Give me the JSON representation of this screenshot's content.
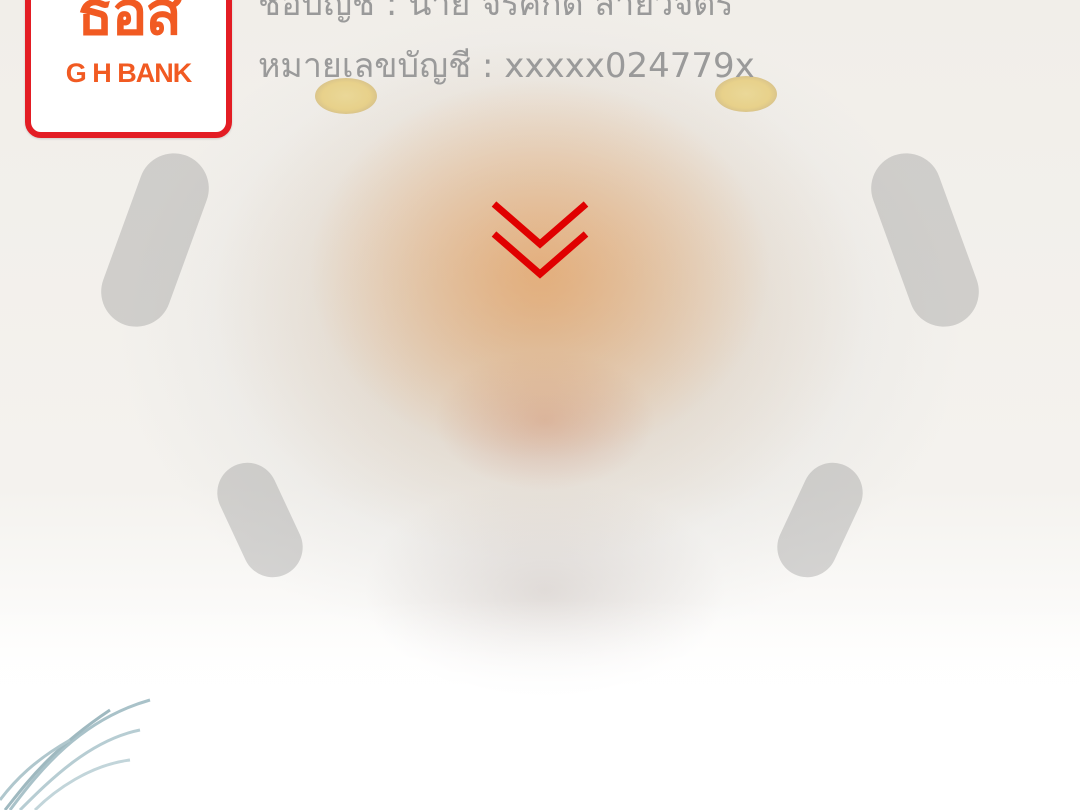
{
  "logo": {
    "thai_text": "ธอส",
    "english_text": "G H BANK",
    "border_color": "#e31d24",
    "text_color": "#f15a22"
  },
  "account": {
    "name_line": "ชื่อบัญชี : นาย จีรศักดิ์ สายวิจิตร",
    "number_line": "หมายเลขบัญชี : xxxxx024779x"
  },
  "chevron": {
    "icon": "double-chevron-down-icon",
    "color": "#e00000"
  },
  "background": {
    "image": "faded tiger face"
  }
}
